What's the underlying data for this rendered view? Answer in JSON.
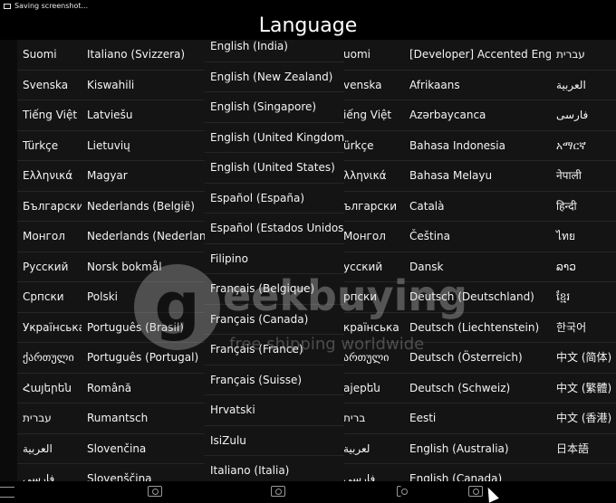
{
  "status_bar": {
    "notification_text": "Saving screenshot..."
  },
  "title": "Language",
  "columns": {
    "a": [
      "Suomi",
      "Svenska",
      "Tiếng Việt",
      "Türkçe",
      "Ελληνικά",
      "Български",
      "Монгол",
      "Русский",
      "Српски",
      "Українська",
      "ქართული",
      "Հայերեն",
      "עברית",
      "العربية",
      "فارسی"
    ],
    "b": [
      "Italiano (Svizzera)",
      "Kiswahili",
      "Latviešu",
      "Lietuvių",
      "Magyar",
      "Nederlands (België)",
      "Nederlands (Nederland)",
      "Norsk bokmål",
      "Polski",
      "Português (Brasil)",
      "Português (Portugal)",
      "Română",
      "Rumantsch",
      "Slovenčina",
      "Slovenščina"
    ],
    "c": [
      "English (India)",
      "English (New Zealand)",
      "English (Singapore)",
      "English (United Kingdom)",
      "English (United States)",
      "Español (España)",
      "Español (Estados Unidos)",
      "Filipino",
      "Français (Belgique)",
      "Français (Canada)",
      "Français (France)",
      "Français (Suisse)",
      "Hrvatski",
      "IsiZulu",
      "Italiano (Italia)"
    ],
    "d": [
      "uomi",
      "venska",
      "iếng Việt",
      "ürkçe",
      "λληνικά",
      "ългарски",
      "Монгол",
      "усский",
      "рпски",
      "країнська",
      "ართული",
      "ајерեն",
      "ברית",
      "لعربية",
      "فارسی"
    ],
    "e": [
      "[Developer] Accented English",
      "Afrikaans",
      "Azərbaycanca",
      "Bahasa Indonesia",
      "Bahasa Melayu",
      "Català",
      "Čeština",
      "Dansk",
      "Deutsch (Deutschland)",
      "Deutsch (Liechtenstein)",
      "Deutsch (Österreich)",
      "Deutsch (Schweiz)",
      "Eesti",
      "English (Australia)",
      "English (Canada)"
    ],
    "f": [
      "עברית",
      "العربية",
      "فارسی",
      "አማርኛ",
      "नेपाली",
      "हिन्दी",
      "ไทย",
      "ລາວ",
      "ខ្មែរ",
      "한국어",
      "中文 (简体)",
      "中文 (繁體)",
      "中文 (香港)",
      "日本語",
      ""
    ]
  },
  "watermark": {
    "brand": "eekbuying",
    "tagline": "free shipping worldwide"
  },
  "nav_icons": [
    "screenshot-icon",
    "screenshot-icon",
    "screenshot-icon",
    "screenshot-icon"
  ]
}
